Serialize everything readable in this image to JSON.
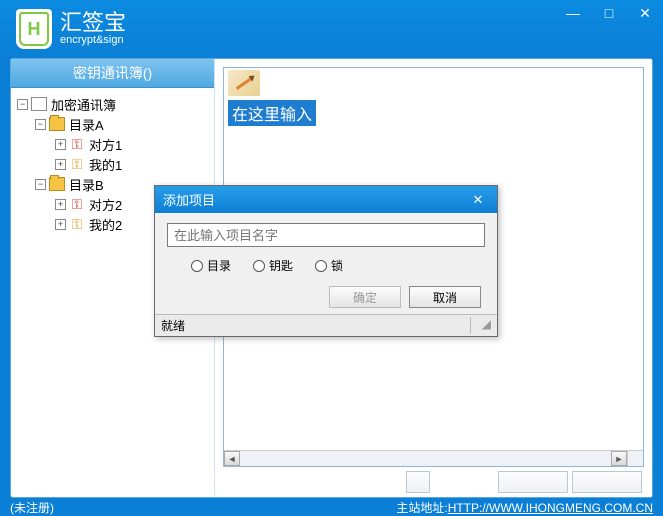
{
  "app": {
    "title": "汇签宝",
    "subtitle": "encrypt&sign",
    "logoLetter": "H"
  },
  "winControls": {
    "min": "—",
    "max": "□",
    "close": "✕"
  },
  "sidebar": {
    "header": "密钥通讯簿()",
    "tree": {
      "root": "加密通讯簿",
      "dirA": "目录A",
      "dirA_item1": "对方1",
      "dirA_item2": "我的1",
      "dirB": "目录B",
      "dirB_item1": "对方2",
      "dirB_item2": "我的2"
    }
  },
  "content": {
    "selectedLabel": "在这里输入"
  },
  "dialog": {
    "title": "添加项目",
    "placeholder": "在此输入项目名字",
    "radio1": "目录",
    "radio2": "钥匙",
    "radio3": "锁",
    "ok": "确定",
    "cancel": "取消",
    "status": "就绪"
  },
  "footer": {
    "left": "(未注册)",
    "rightLabel": "主站地址:",
    "url": "HTTP://WWW.IHONGMENG.COM.CN"
  }
}
